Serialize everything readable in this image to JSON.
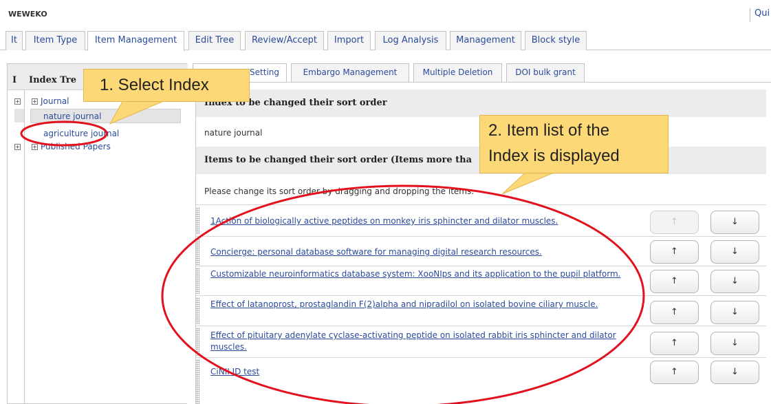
{
  "header": {
    "brand": "WEWEKO",
    "quick": "Qui"
  },
  "main_tabs": [
    {
      "label": "It"
    },
    {
      "label": "Item Type"
    },
    {
      "label": "Item Management",
      "active": true
    },
    {
      "label": "Edit Tree"
    },
    {
      "label": "Review/Accept"
    },
    {
      "label": "Import"
    },
    {
      "label": "Log Analysis"
    },
    {
      "label": "Management"
    },
    {
      "label": "Block style"
    }
  ],
  "left_panel": {
    "header_prefix": "I",
    "title": "Index Tre",
    "tree": [
      {
        "label": "Journal",
        "children": [
          "nature journal",
          "agriculture journal"
        ]
      },
      {
        "label": "Published Papers"
      }
    ]
  },
  "sub_tabs": [
    {
      "label": "Setting",
      "active": true
    },
    {
      "label": "Embargo Management"
    },
    {
      "label": "Multiple Deletion"
    },
    {
      "label": "DOI bulk grant"
    }
  ],
  "content": {
    "index_section_title": "Index to be changed their sort order",
    "selected_index": "nature journal",
    "items_section_title": "Items to be changed their sort order (Items more tha",
    "instruction": "Please change its sort order by dragging and dropping the items.",
    "items": [
      {
        "title": "1Action of biologically active peptides on monkey iris sphincter and dilator muscles.",
        "up": "↑",
        "down": "↓",
        "up_disabled": true
      },
      {
        "title": "Concierge: personal database software for managing digital research resources.",
        "up": "↑",
        "down": "↓"
      },
      {
        "title": "Customizable neuroinformatics database system: XooNIps and its application to the pupil platform.",
        "up": "↑",
        "down": "↓"
      },
      {
        "title": "Effect of latanoprost, prostaglandin F(2)alpha and nipradilol on isolated bovine ciliary muscle.",
        "up": "↑",
        "down": "↓"
      },
      {
        "title": "Effect of pituitary adenylate cyclase-activating peptide on isolated rabbit iris sphincter and dilator muscles.",
        "up": "↑",
        "down": "↓"
      },
      {
        "title": "CiNII ID test",
        "up": "↑",
        "down": "↓"
      }
    ]
  },
  "callouts": {
    "select_index": "1. Select Index",
    "item_list_line1": "2. Item list of the",
    "item_list_line2": "Index is displayed"
  },
  "colors": {
    "callout_fill": "#fdd876",
    "annotation_red": "#e3101e",
    "link": "#2a4a9a"
  }
}
